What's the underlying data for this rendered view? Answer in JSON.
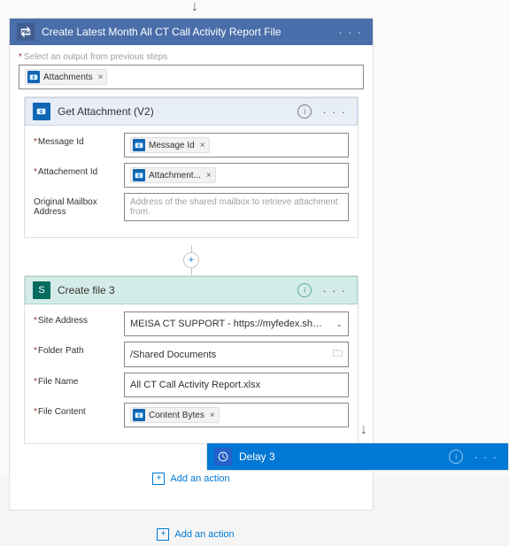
{
  "outer": {
    "title": "Create Latest Month All CT Call Activity Report File",
    "hint": "Select an output from previous steps",
    "token": "Attachments"
  },
  "getAttachment": {
    "title": "Get Attachment (V2)",
    "fields": {
      "msgIdLabel": "Message Id",
      "msgIdToken": "Message Id",
      "attIdLabel": "Attachement Id",
      "attIdToken": "Attachment...",
      "mailboxLabel": "Original Mailbox Address",
      "mailboxPlaceholder": "Address of the shared mailbox to retrieve attachment from."
    }
  },
  "createFile": {
    "title": "Create file 3",
    "fields": {
      "siteLabel": "Site Address",
      "siteValue": "MEISA CT SUPPORT - https://myfedex.sharepoint.com/teams/...",
      "folderLabel": "Folder Path",
      "folderValue": "/Shared Documents",
      "fileNameLabel": "File Name",
      "fileNameValue": "All CT Call Activity Report.xlsx",
      "fileContentLabel": "File Content",
      "fileContentToken": "Content Bytes"
    }
  },
  "addAction": "Add an action",
  "delay": {
    "title": "Delay 3"
  }
}
